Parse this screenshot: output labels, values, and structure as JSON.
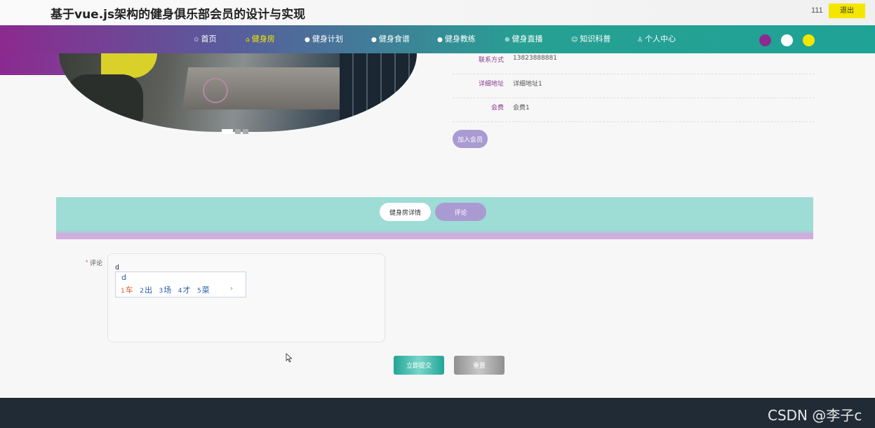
{
  "header": {
    "site_title": "基于vue.js架构的健身俱乐部会员的设计与实现",
    "user_name": "111",
    "logout_label": "退出"
  },
  "nav": {
    "items": [
      {
        "icon": "star-icon",
        "glyph": "✩",
        "label": "首页",
        "active": false
      },
      {
        "icon": "gym-icon",
        "glyph": "⌂",
        "label": "健身房",
        "active": true
      },
      {
        "icon": "info-icon",
        "glyph": "●",
        "label": "健身计划",
        "active": false
      },
      {
        "icon": "info-icon",
        "glyph": "●",
        "label": "健身食谱",
        "active": false
      },
      {
        "icon": "info-icon",
        "glyph": "●",
        "label": "健身教练",
        "active": false
      },
      {
        "icon": "plus-circle-icon",
        "glyph": "⊕",
        "label": "健身直播",
        "active": false
      },
      {
        "icon": "smile-icon",
        "glyph": "☺",
        "label": "知识科普",
        "active": false
      },
      {
        "icon": "user-icon",
        "glyph": "♙",
        "label": "个人中心",
        "active": false
      }
    ],
    "theme_colors": [
      "#8c2a8f",
      "#ffffff",
      "#f5e600"
    ]
  },
  "detail": {
    "rows": [
      {
        "label": "联系方式",
        "value": "13823888881"
      },
      {
        "label": "详细地址",
        "value": "详细地址1"
      },
      {
        "label": "会费",
        "value": "会费1"
      }
    ],
    "join_label": "加入会员"
  },
  "tabs": {
    "detail_label": "健身房详情",
    "comment_label": "评论"
  },
  "comment_form": {
    "label": "评论",
    "required_mark": "*",
    "value": "d",
    "ime": {
      "input": "d",
      "candidates": [
        {
          "n": "1",
          "text": "车"
        },
        {
          "n": "2",
          "text": "出"
        },
        {
          "n": "3",
          "text": "场"
        },
        {
          "n": "4",
          "text": "才"
        },
        {
          "n": "5",
          "text": "菜"
        }
      ],
      "more": "›"
    },
    "submit_label": "立即提交",
    "reset_label": "重置"
  },
  "watermark": "CSDN @李子c"
}
